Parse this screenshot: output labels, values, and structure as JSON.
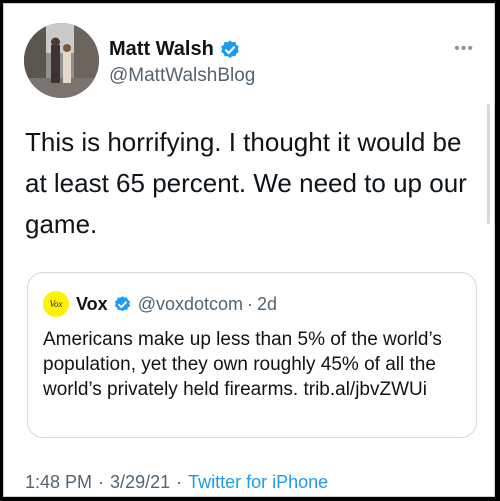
{
  "author": {
    "name": "Matt Walsh",
    "handle": "@MattWalshBlog",
    "verified": true
  },
  "more_label": "•••",
  "tweet_text": "This is horrifying. I thought it would be at least 65 percent. We need to up our game.",
  "quoted_tweet": {
    "logo_text": "Vox",
    "name": "Vox",
    "handle": "@voxdotcom",
    "separator": "·",
    "time": "2d",
    "text": "Americans make up less than 5% of the world’s population, yet they own roughly 45% of all the world’s privately held firearms. trib.al/jbvZWUi"
  },
  "meta": {
    "time": "1:48 PM",
    "date": "3/29/21",
    "separator": "·",
    "source": "Twitter for iPhone"
  },
  "colors": {
    "verified": "#1d9bf0",
    "link": "#1d9bf0",
    "vox_yellow": "#fff200",
    "secondary_text": "#536471"
  }
}
